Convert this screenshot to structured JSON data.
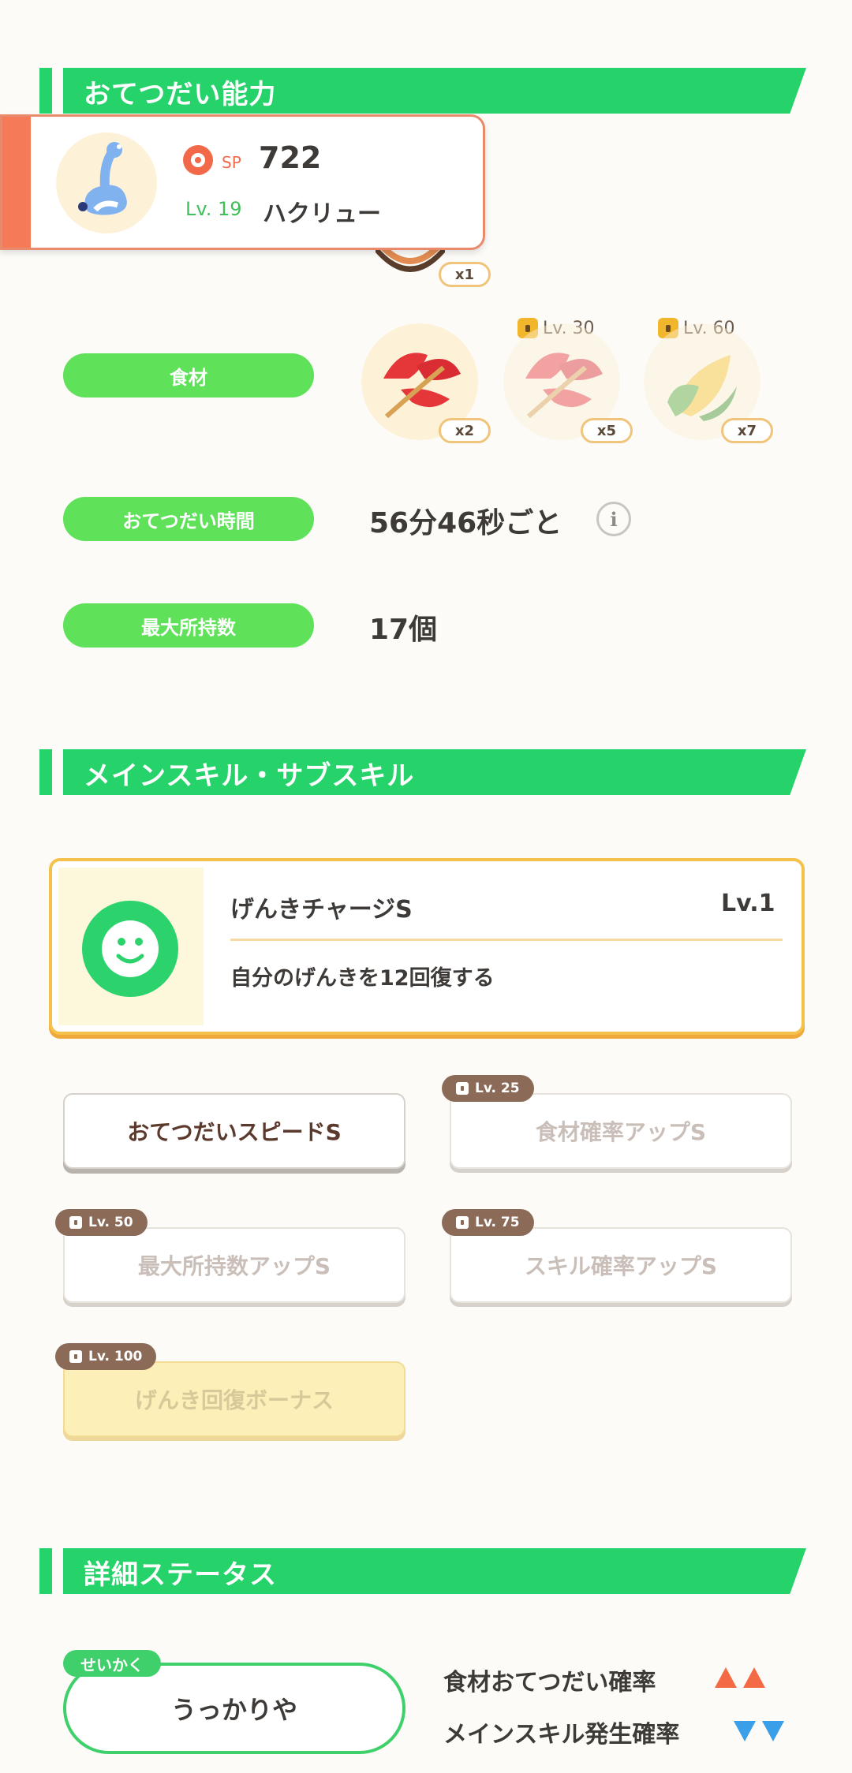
{
  "sections": {
    "help_ability": "おてつだい能力",
    "skills": "メインスキル・サブスキル",
    "detail_status": "詳細ステータス"
  },
  "popup": {
    "sp_label": "SP",
    "sp_value": "722",
    "level": "Lv. 19",
    "name": "ハクリュー"
  },
  "berry": {
    "qty": "x1"
  },
  "ingredients": {
    "label": "食材",
    "items": [
      {
        "name": "leaf",
        "qty": "x2",
        "lock": ""
      },
      {
        "name": "leaf",
        "qty": "x5",
        "lock": "Lv. 30"
      },
      {
        "name": "corn",
        "qty": "x7",
        "lock": "Lv. 60"
      }
    ]
  },
  "help_time": {
    "label": "おてつだい時間",
    "value": "56分46秒ごと"
  },
  "max_carry": {
    "label": "最大所持数",
    "value": "17個"
  },
  "main_skill": {
    "name": "げんきチャージS",
    "level": "Lv.1",
    "desc": "自分のげんきを12回復する"
  },
  "sub_skills": [
    {
      "label": "おてつだいスピードS",
      "lock": ""
    },
    {
      "label": "食材確率アップS",
      "lock": "Lv. 25"
    },
    {
      "label": "最大所持数アップS",
      "lock": "Lv. 50"
    },
    {
      "label": "スキル確率アップS",
      "lock": "Lv. 75"
    },
    {
      "label": "げんき回復ボーナス",
      "lock": "Lv. 100"
    }
  ],
  "nature": {
    "tag": "せいかく",
    "value": "うっかりや",
    "up_label": "食材おてつだい確率",
    "down_label": "メインスキル発生確率"
  },
  "colors": {
    "green": "#26d36a",
    "pill_green": "#5fe25a",
    "up_arrow": "#f36a45",
    "down_arrow": "#3a9fe8"
  }
}
